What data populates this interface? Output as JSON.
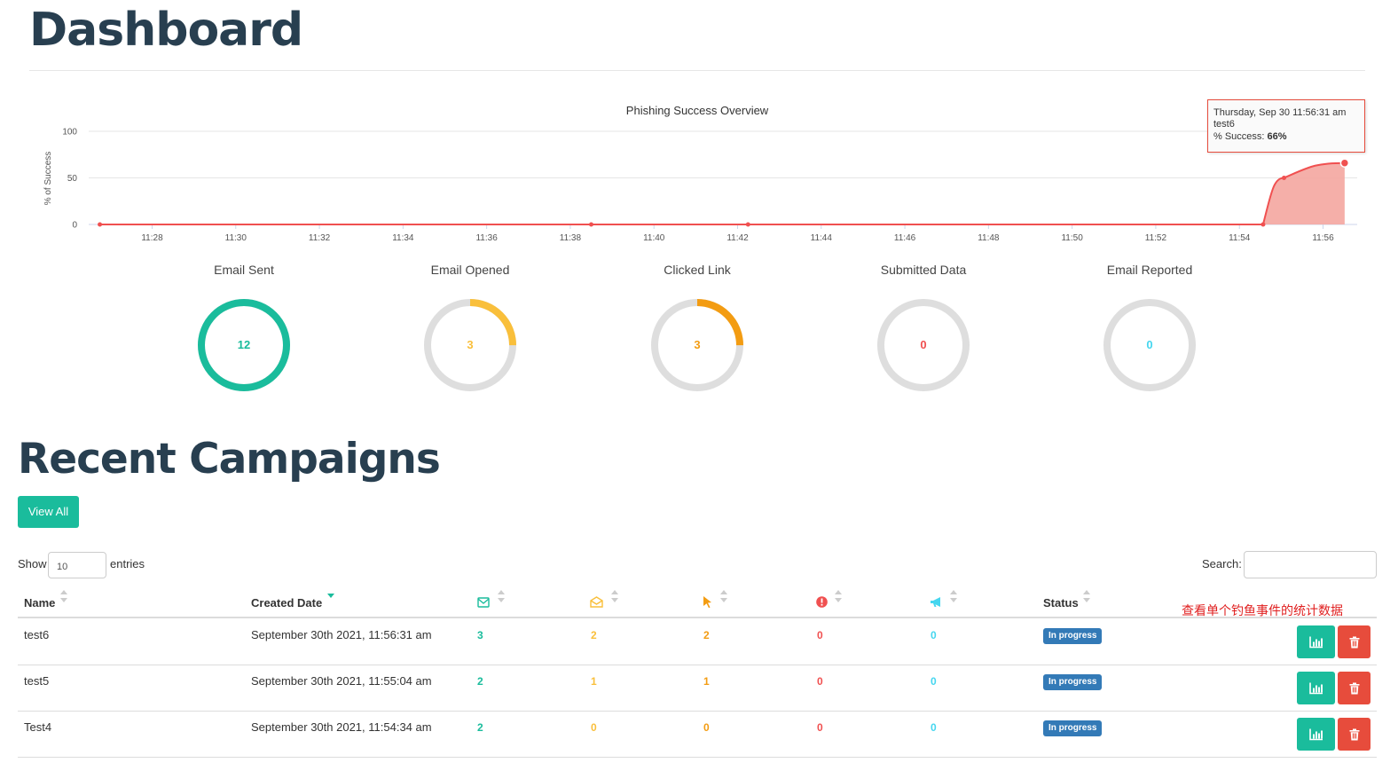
{
  "page": {
    "title": "Dashboard"
  },
  "chart_data": {
    "type": "area",
    "title": "Phishing Success Overview",
    "ylabel": "% of Success",
    "xlabel": "",
    "ylim": [
      0,
      100
    ],
    "yticks": [
      "0",
      "50",
      "100"
    ],
    "xticks": [
      "11:28",
      "11:30",
      "11:32",
      "11:34",
      "11:36",
      "11:38",
      "11:40",
      "11:42",
      "11:44",
      "11:46",
      "11:48",
      "11:50",
      "11:52",
      "11:54",
      "11:56"
    ],
    "series": [
      {
        "name": "",
        "color": "#f05050",
        "fill": "#f4a6a0",
        "points": [
          {
            "x": "11:26:45",
            "y": 0
          },
          {
            "x": "11:38:30",
            "y": 0
          },
          {
            "x": "11:42:15",
            "y": 0
          },
          {
            "x": "11:54:34",
            "y": 0
          },
          {
            "x": "11:55:04",
            "y": 50
          },
          {
            "x": "11:56:31",
            "y": 66
          }
        ]
      }
    ],
    "tooltip": {
      "date": "Thursday, Sep 30 11:56:31 am",
      "name": "test6",
      "label": "% Success:",
      "value": "66%"
    }
  },
  "stats": [
    {
      "label": "Email Sent",
      "value": "12",
      "fraction": 1.0,
      "color": "#1abc9c"
    },
    {
      "label": "Email Opened",
      "value": "3",
      "fraction": 0.25,
      "color": "#f9bf3b"
    },
    {
      "label": "Clicked Link",
      "value": "3",
      "fraction": 0.25,
      "color": "#f39c12"
    },
    {
      "label": "Submitted Data",
      "value": "0",
      "fraction": 0,
      "color": "#f05050"
    },
    {
      "label": "Email Reported",
      "value": "0",
      "fraction": 0,
      "color": "#45d6ef"
    }
  ],
  "recent": {
    "title": "Recent Campaigns",
    "view_all": "View All",
    "show": "Show",
    "entries_value": "10",
    "entries": "entries",
    "search": "Search:",
    "columns": {
      "name": "Name",
      "created": "Created Date",
      "status": "Status"
    },
    "annotation": "查看单个钓鱼事件的统计数据",
    "colors": {
      "sent": "#1abc9c",
      "opened": "#f9bf3b",
      "clicked": "#f39c12",
      "submitted": "#f05050",
      "reported": "#45d6ef"
    },
    "rows": [
      {
        "name": "test6",
        "created": "September 30th 2021, 11:56:31 am",
        "sent": "3",
        "opened": "2",
        "clicked": "2",
        "submitted": "0",
        "reported": "0",
        "status": "In progress"
      },
      {
        "name": "test5",
        "created": "September 30th 2021, 11:55:04 am",
        "sent": "2",
        "opened": "1",
        "clicked": "1",
        "submitted": "0",
        "reported": "0",
        "status": "In progress"
      },
      {
        "name": "Test4",
        "created": "September 30th 2021, 11:54:34 am",
        "sent": "2",
        "opened": "0",
        "clicked": "0",
        "submitted": "0",
        "reported": "0",
        "status": "In progress"
      }
    ]
  }
}
